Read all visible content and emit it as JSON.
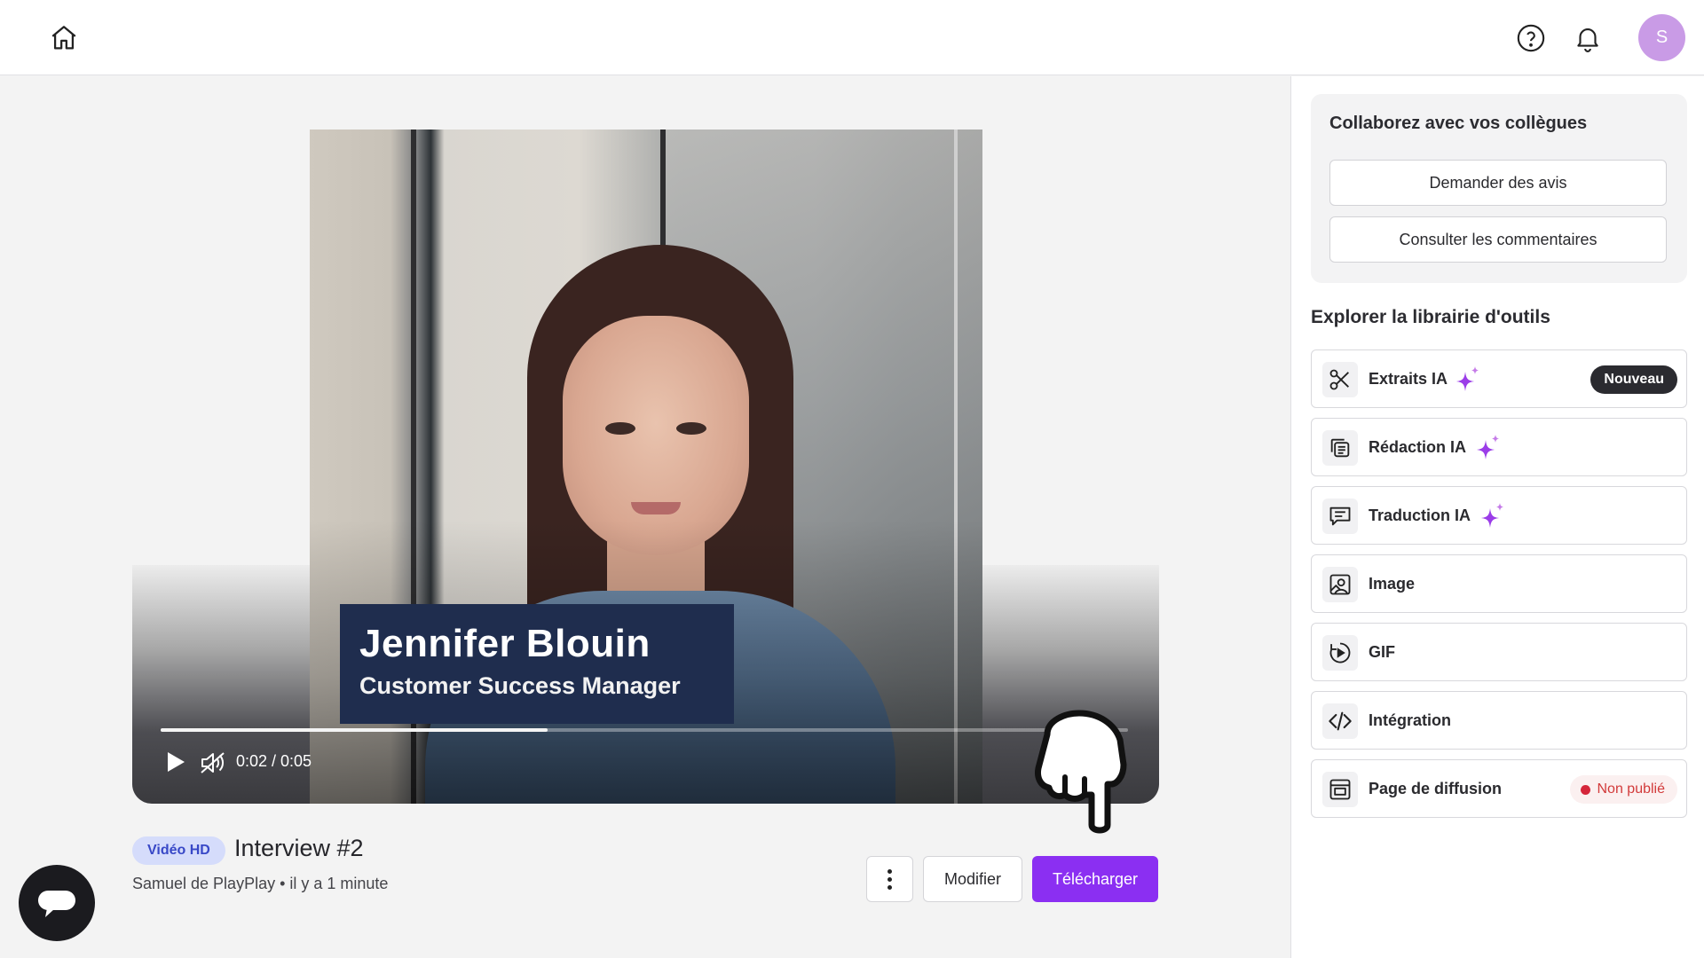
{
  "colors": {
    "accent": "#8b2ff2",
    "avatar_bg": "#c99be6",
    "badge_bg": "#d5dcfb",
    "badge_text": "#3848c7",
    "unpublished": "#d5263a",
    "lower_third_bg": "#1f2d4e"
  },
  "header": {
    "icons": [
      "home-icon",
      "help-circle-icon",
      "bell-icon"
    ],
    "avatar_initial": "S"
  },
  "video": {
    "overlay_name": "Jennifer Blouin",
    "overlay_role": "Customer Success Manager",
    "time_display": "0:02 / 0:05",
    "progress_fraction": 0.4,
    "badge": "Vidéo HD",
    "title": "Interview #2",
    "subtitle": "Samuel de PlayPlay • il y a 1 minute",
    "controls": [
      "play-icon",
      "volume-muted-icon"
    ]
  },
  "actions": {
    "more_icon": "more-vertical-icon",
    "edit_label": "Modifier",
    "download_label": "Télécharger"
  },
  "sidebar": {
    "collab": {
      "title": "Collaborez avec vos collègues",
      "request_label": "Demander des avis",
      "comments_label": "Consulter les commentaires"
    },
    "tools_title": "Explorer la librairie d'outils",
    "tools": [
      {
        "label": "Extraits IA",
        "icon": "scissors-icon",
        "sparkle": true,
        "pill": "Nouveau"
      },
      {
        "label": "Rédaction IA",
        "icon": "copy-document-icon",
        "sparkle": true
      },
      {
        "label": "Traduction IA",
        "icon": "chat-bubble-icon",
        "sparkle": true
      },
      {
        "label": "Image",
        "icon": "image-icon",
        "sparkle": false
      },
      {
        "label": "GIF",
        "icon": "gif-play-icon",
        "sparkle": false
      },
      {
        "label": "Intégration",
        "icon": "code-icon",
        "sparkle": false
      },
      {
        "label": "Page de diffusion",
        "icon": "browser-page-icon",
        "sparkle": false,
        "status": "Non publié"
      }
    ]
  },
  "chat_widget": {
    "icon": "chat-icon"
  }
}
